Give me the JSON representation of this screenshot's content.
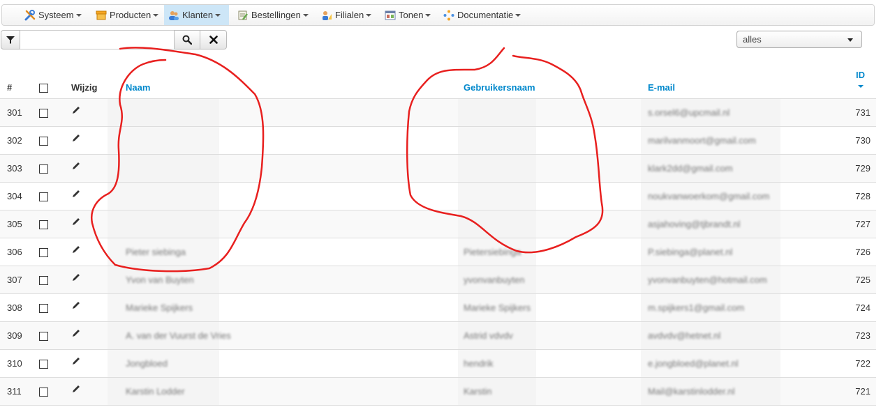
{
  "menu": {
    "items": [
      {
        "label": "Systeem",
        "icon": "tools-icon"
      },
      {
        "label": "Producten",
        "icon": "box-icon"
      },
      {
        "label": "Klanten",
        "icon": "users-icon",
        "active": true
      },
      {
        "label": "Bestellingen",
        "icon": "order-icon"
      },
      {
        "label": "Filialen",
        "icon": "branch-icon"
      },
      {
        "label": "Tonen",
        "icon": "window-icon"
      },
      {
        "label": "Documentatie",
        "icon": "docs-icon"
      }
    ]
  },
  "toolbar": {
    "filter_value": "",
    "filter_placeholder": "",
    "select_value": "alles"
  },
  "table": {
    "headers": {
      "num": "#",
      "edit": "Wijzig",
      "name": "Naam",
      "username": "Gebruikersnaam",
      "email": "E-mail",
      "id": "ID"
    },
    "sort": {
      "column": "id",
      "direction": "desc"
    },
    "rows": [
      {
        "num": "301",
        "name": "",
        "username": "",
        "email": "s.orsel6@upcmail.nl",
        "id": "731"
      },
      {
        "num": "302",
        "name": "",
        "username": "",
        "email": "marilvanmoort@gmail.com",
        "id": "730"
      },
      {
        "num": "303",
        "name": "",
        "username": "",
        "email": "klark2dd@gmail.com",
        "id": "729"
      },
      {
        "num": "304",
        "name": "",
        "username": "",
        "email": "noukvanwoerkom@gmail.com",
        "id": "728"
      },
      {
        "num": "305",
        "name": "",
        "username": "",
        "email": "asjahoving@tjbrandt.nl",
        "id": "727"
      },
      {
        "num": "306",
        "name": "Pieter siebinga",
        "username": "Pietersiebinga",
        "email": "P.siebinga@planet.nl",
        "id": "726"
      },
      {
        "num": "307",
        "name": "Yvon van Buyten",
        "username": "yvonvanbuyten",
        "email": "yvonvanbuyten@hotmail.com",
        "id": "725"
      },
      {
        "num": "308",
        "name": "Marieke Spijkers",
        "username": "Marieke Spijkers",
        "email": "m.spijkers1@gmail.com",
        "id": "724"
      },
      {
        "num": "309",
        "name": "A. van der Vuurst de Vries",
        "username": "Astrid vdvdv",
        "email": "avdvdv@hetnet.nl",
        "id": "723"
      },
      {
        "num": "310",
        "name": "Jongbloed",
        "username": "hendrik",
        "email": "e.jongbloed@planet.nl",
        "id": "722"
      },
      {
        "num": "311",
        "name": "Karstin Lodder",
        "username": "Karstin",
        "email": "Mail@karstinlodder.nl",
        "id": "721"
      }
    ]
  },
  "colors": {
    "link": "#0088cc",
    "active_menu": "#cde6f7",
    "annotation": "#e8201f"
  }
}
